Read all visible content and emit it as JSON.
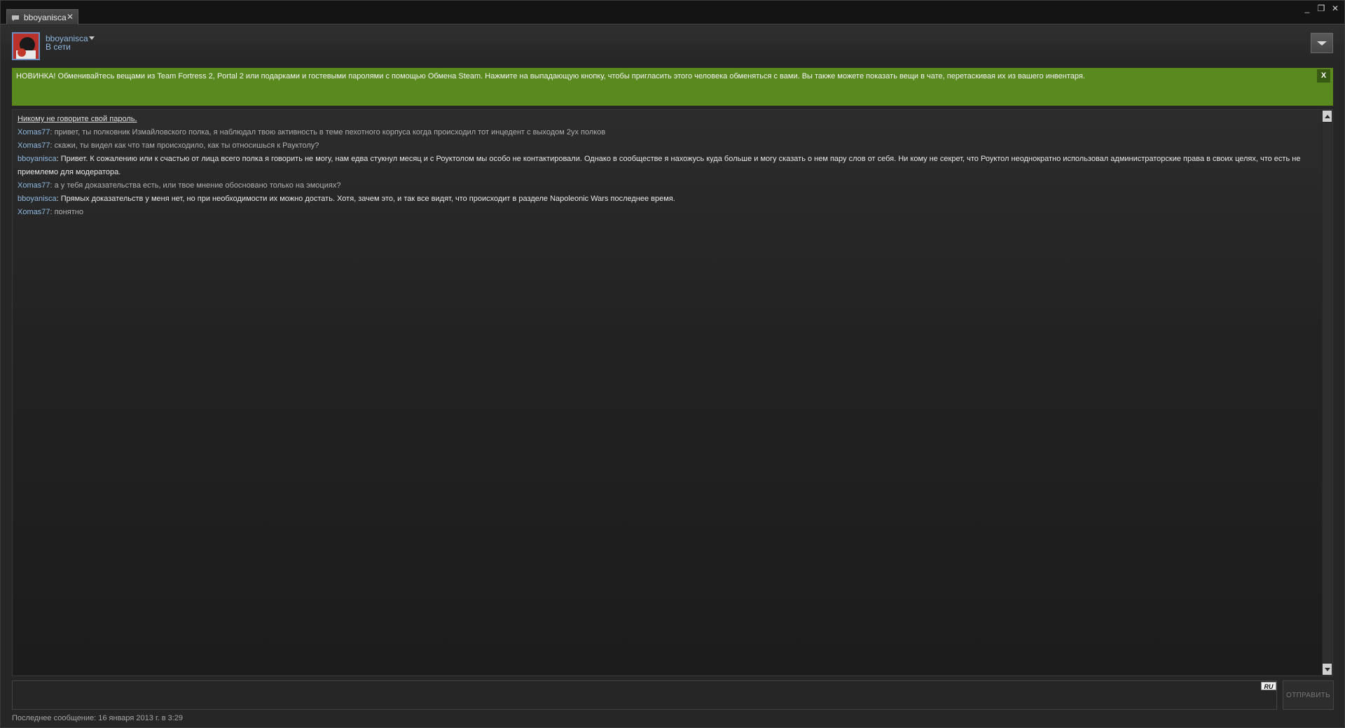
{
  "window": {
    "tab_label": "bboyanisca",
    "tab_close": "✕",
    "controls": {
      "minimize": "_",
      "restore": "❐",
      "close": "✕"
    }
  },
  "header": {
    "username": "bboyanisca",
    "status": "В сети"
  },
  "notice": {
    "text": "НОВИНКА! Обменивайтесь вещами из Team Fortress 2, Portal 2 или подарками и гостевыми паролями с помощью Обмена Steam. Нажмите на выпадающую кнопку, чтобы пригласить этого человека обменяться с вами. Вы также можете показать вещи в чате, перетаскивая их из вашего инвентаря.",
    "close": "X",
    "color": "#5a8a1f"
  },
  "chat": {
    "warning": "Никому не говорите свой пароль.",
    "messages": [
      {
        "name": "Xomas77",
        "text": ": привет, ты полковник Измайловского полка, я наблюдал твою активность в теме пехотного корпуса когда происходил тот инцедент с выходом 2ух полков"
      },
      {
        "name": "Xomas77",
        "text": ": скажи, ты видел как что там происходило, как    ты относишься к Рауктолу?"
      },
      {
        "name": "bboyanisca",
        "text": ": Привет. К сожалению или к счастью от лица всего полка я говорить не могу, нам едва стукнул месяц и с Роуктолом мы особо не контактировали. Однако в сообществе я нахожусь куда больше и могу сказать о нем пару слов от себя. Ни кому не секрет, что Роуктол неоднократно использовал администраторские права в своих целях, что есть не приемлемо для модератора."
      },
      {
        "name": "Xomas77",
        "text": ": а у тебя доказательства есть, или твое мнение обосновано только на эмоциях?"
      },
      {
        "name": "bboyanisca",
        "text": ": Прямых доказательств у меня нет,  но при необходимости их можно достать. Хотя, зачем это, и так все видят, что происходит в разделе Napoleonic Wars последнее время."
      },
      {
        "name": "Xomas77",
        "text": ": понятно"
      }
    ]
  },
  "input": {
    "value": "",
    "lang": "RU",
    "send_label": "ОТПРАВИТЬ"
  },
  "footer": {
    "last_message": "Последнее сообщение: 16 января 2013 г. в 3:29"
  }
}
